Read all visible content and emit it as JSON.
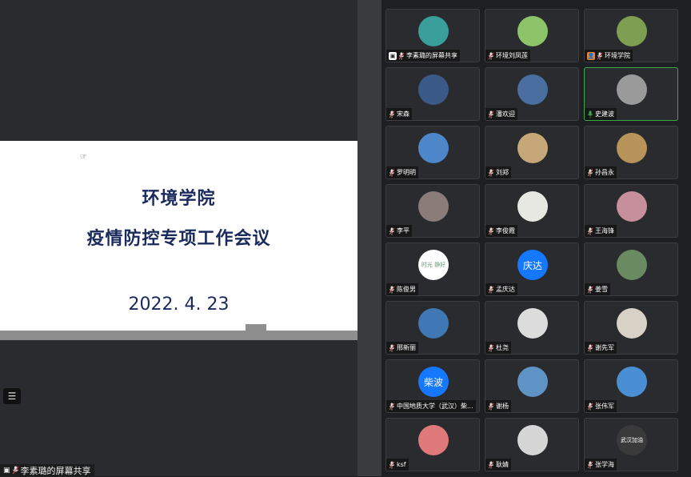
{
  "slide": {
    "title_line1": "环境学院",
    "title_line2": "疫情防控专项工作会议",
    "date": "2022. 4. 23"
  },
  "share_label": "李素璐的屏幕共享",
  "colors": {
    "background": "#1e1f22",
    "tile": "#2a2b2e",
    "active_border": "#3da84a",
    "muted_mic": "#e05a5a",
    "slide_title": "#1b2a5c"
  },
  "participants": [
    {
      "name": "李素璐的屏幕共享",
      "avatar_color": "#3a9e9b",
      "icon": "screen-share-icon",
      "mic": "muted"
    },
    {
      "name": "环境刘凤莲",
      "avatar_color": "#8dc46a",
      "mic": "muted"
    },
    {
      "name": "环境学院",
      "avatar_color": "#7d9f52",
      "icon": "person-badge-icon",
      "mic": "muted"
    },
    {
      "name": "宋森",
      "avatar_color": "#3a5a88",
      "mic": "muted"
    },
    {
      "name": "潘欢迎",
      "avatar_color": "#4a6ea0",
      "mic": "muted"
    },
    {
      "name": "史建波",
      "avatar_color": "#9a9a9a",
      "mic": "active",
      "active": true
    },
    {
      "name": "罗明明",
      "avatar_color": "#4d87c9",
      "mic": "muted"
    },
    {
      "name": "刘郑",
      "avatar_color": "#c6a878",
      "mic": "muted"
    },
    {
      "name": "孙昌永",
      "avatar_color": "#b8935a",
      "mic": "muted"
    },
    {
      "name": "李平",
      "avatar_color": "#8a7c78",
      "mic": "muted"
    },
    {
      "name": "李俊霞",
      "avatar_color": "#e8e8e2",
      "mic": "muted"
    },
    {
      "name": "王海锋",
      "avatar_color": "#c78e9b",
      "mic": "muted"
    },
    {
      "name": "陈俊男",
      "avatar_color": "#ffffff",
      "avatar_text": "时光 静好",
      "mic": "muted"
    },
    {
      "name": "孟庆达",
      "avatar_color": "#1677ff",
      "avatar_text": "庆达",
      "mic": "muted"
    },
    {
      "name": "姜雪",
      "avatar_color": "#6a8a62",
      "mic": "muted"
    },
    {
      "name": "邢新丽",
      "avatar_color": "#3f78b5",
      "mic": "muted"
    },
    {
      "name": "杜尧",
      "avatar_color": "#dcdcdc",
      "mic": "muted"
    },
    {
      "name": "谢先军",
      "avatar_color": "#d8d2c6",
      "mic": "muted"
    },
    {
      "name": "中国地质大学（武汉）柴...",
      "avatar_color": "#1677ff",
      "avatar_text": "柴波",
      "mic": "muted"
    },
    {
      "name": "谢杨",
      "avatar_color": "#5f93c6",
      "mic": "muted"
    },
    {
      "name": "张伟军",
      "avatar_color": "#4a8fd4",
      "mic": "muted"
    },
    {
      "name": "ksf",
      "avatar_color": "#e07a7a",
      "mic": "muted"
    },
    {
      "name": "耿婧",
      "avatar_color": "#d6d6d6",
      "mic": "muted"
    },
    {
      "name": "张学海",
      "avatar_color": "#3a3a3a",
      "avatar_text": "武汉加油",
      "mic": "muted"
    }
  ]
}
